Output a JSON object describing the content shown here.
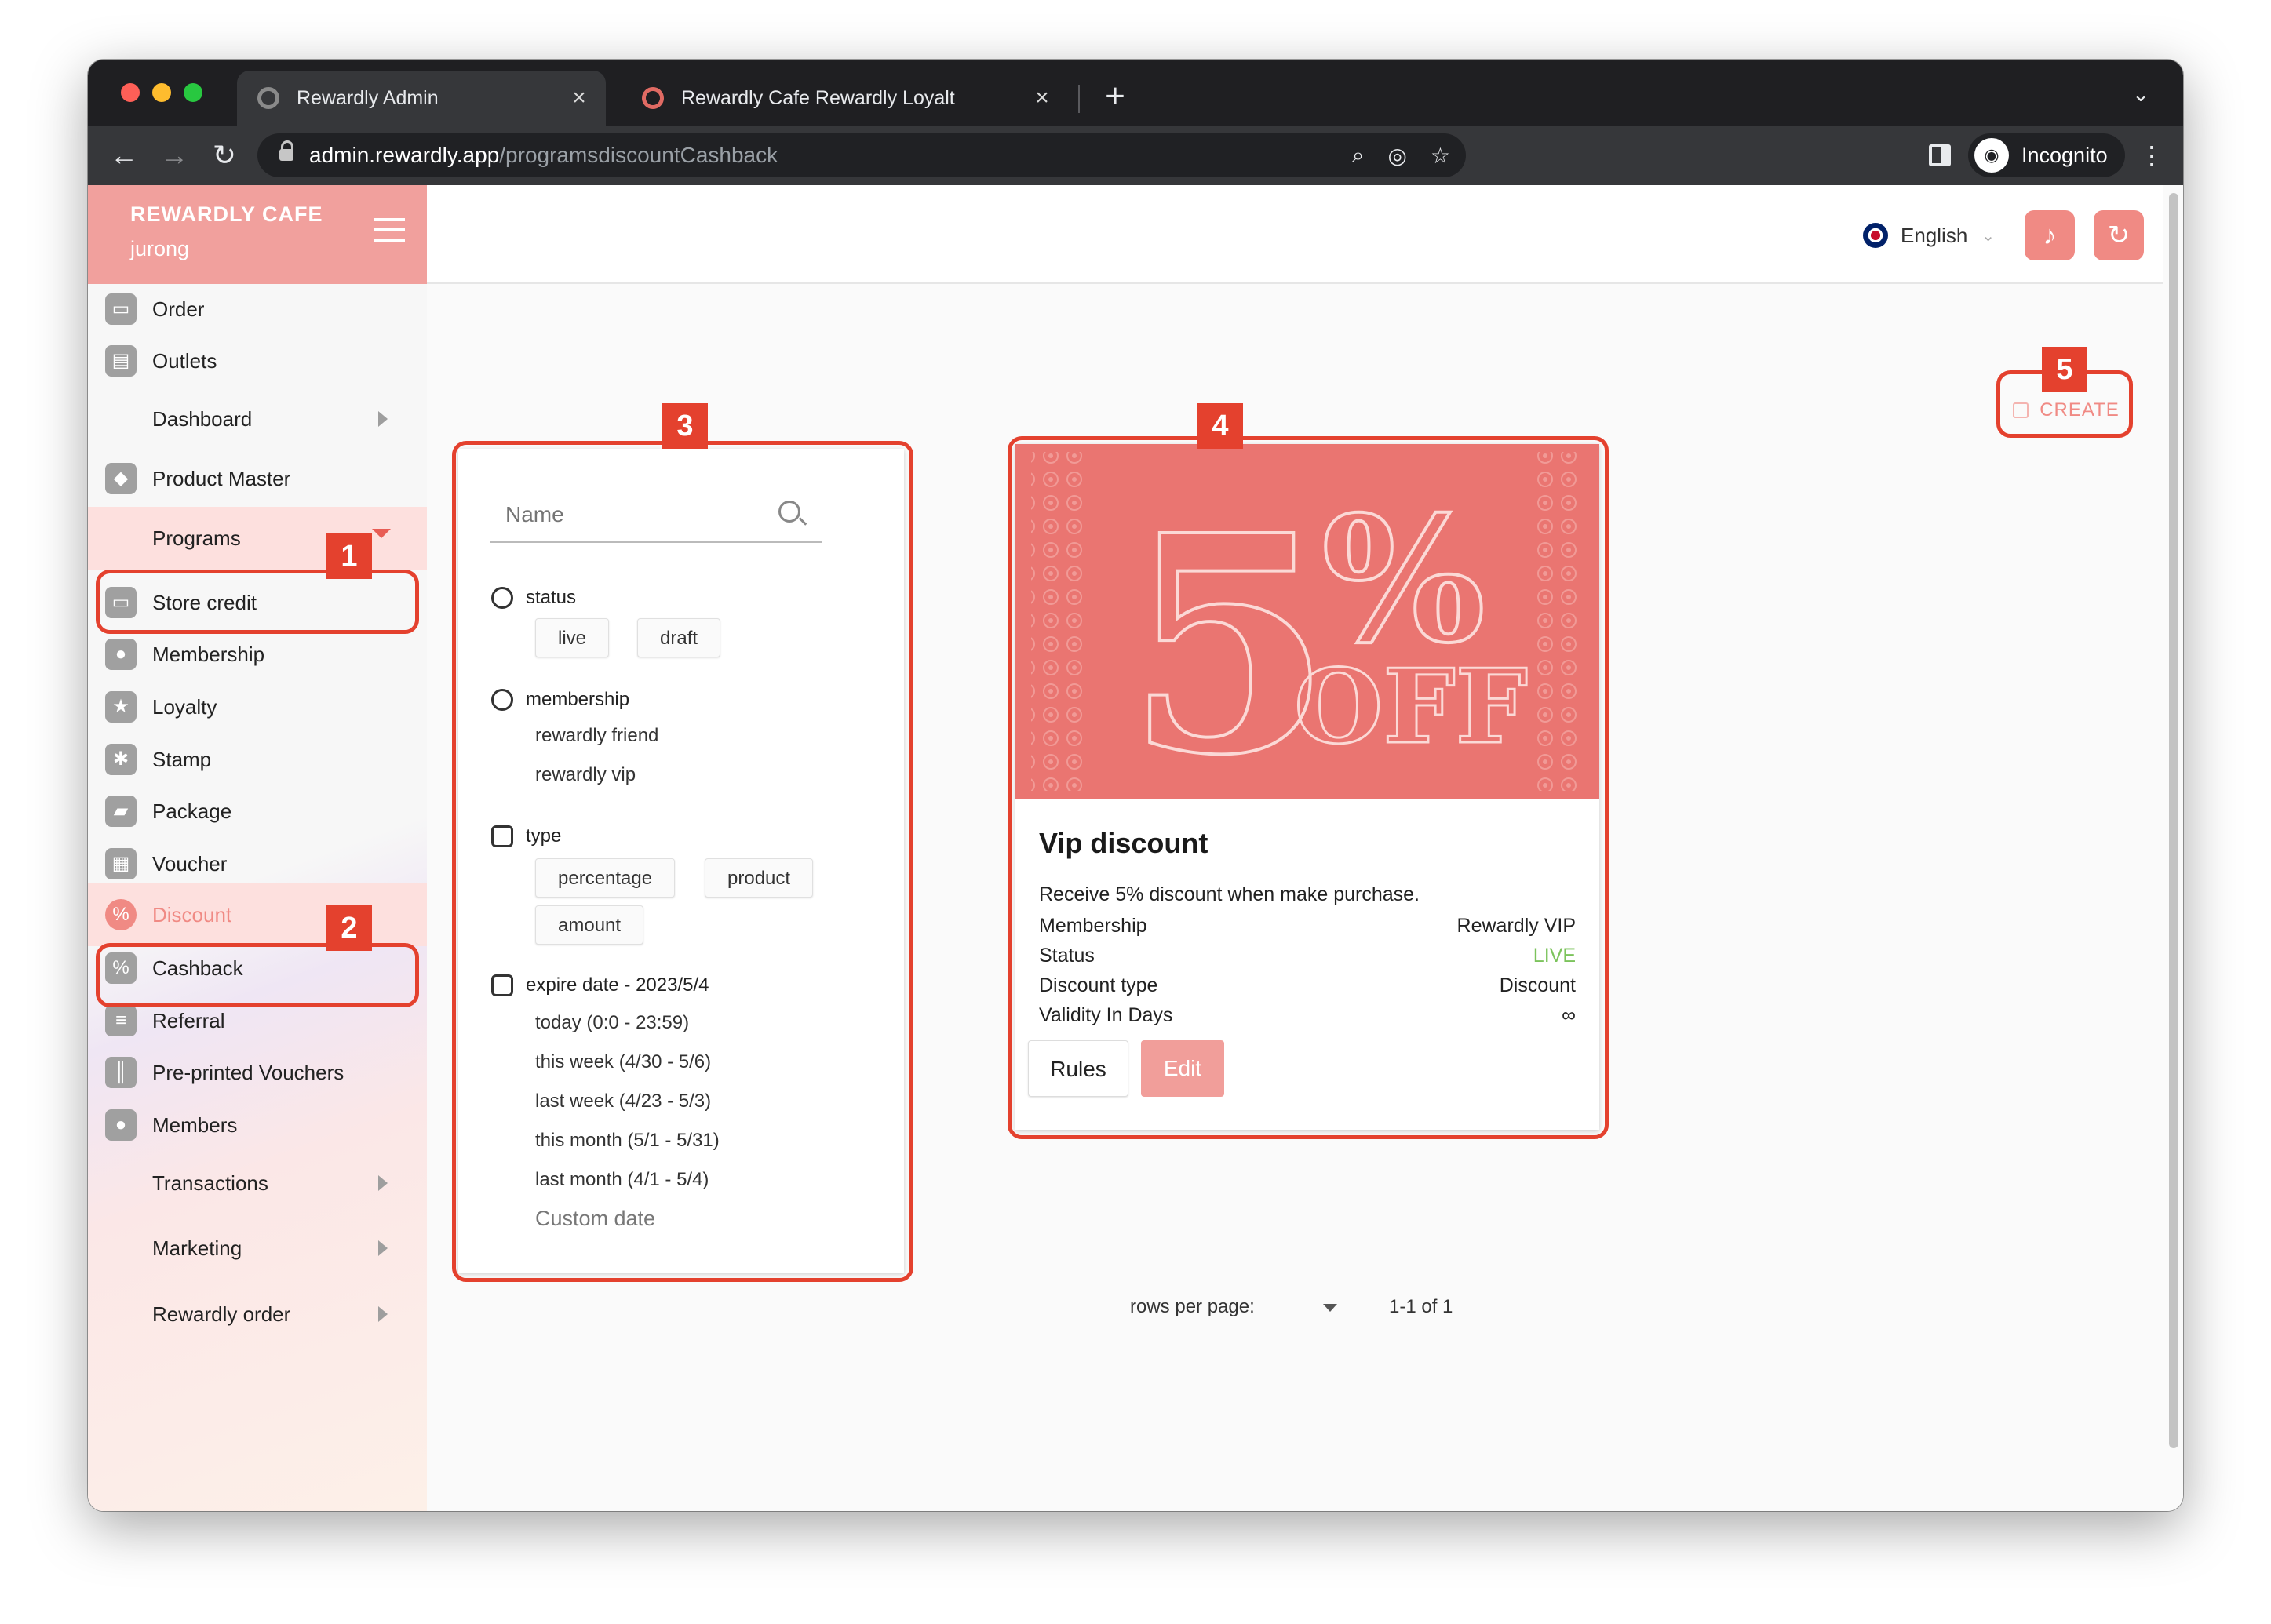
{
  "browser": {
    "tabs": [
      {
        "title": "Rewardly Admin",
        "active": true
      },
      {
        "title": "Rewardly Cafe Rewardly Loyalt",
        "active": false
      }
    ],
    "new_tab": "+",
    "url_domain": "admin.rewardly.app",
    "url_path": "/programsdiscountCashback",
    "profile_label": "Incognito"
  },
  "sidebar": {
    "brand": "REWARDLY CAFE",
    "outlet": "jurong",
    "items": [
      {
        "label": "Order"
      },
      {
        "label": "Outlets"
      },
      {
        "label": "Dashboard"
      },
      {
        "label": "Product Master"
      },
      {
        "label": "Programs"
      },
      {
        "label": "Store credit"
      },
      {
        "label": "Membership"
      },
      {
        "label": "Loyalty"
      },
      {
        "label": "Stamp"
      },
      {
        "label": "Package"
      },
      {
        "label": "Voucher"
      },
      {
        "label": "Discount"
      },
      {
        "label": "Cashback"
      },
      {
        "label": "Referral"
      },
      {
        "label": "Pre-printed Vouchers"
      },
      {
        "label": "Members"
      },
      {
        "label": "Transactions"
      },
      {
        "label": "Marketing"
      },
      {
        "label": "Rewardly order"
      }
    ]
  },
  "topbar": {
    "language": "English"
  },
  "create_button": "CREATE",
  "filters": {
    "search_placeholder": "Name",
    "status": {
      "label": "status",
      "options": [
        "live",
        "draft"
      ]
    },
    "membership": {
      "label": "membership",
      "options": [
        "rewardly friend",
        "rewardly vip"
      ]
    },
    "type": {
      "label": "type",
      "options": [
        "percentage",
        "product",
        "amount"
      ]
    },
    "expire": {
      "label": "expire date - 2023/5/4",
      "options": [
        "today (0:0 - 23:59)",
        "this week (4/30 - 5/6)",
        "last week (4/23 - 5/3)",
        "this month (5/1 - 5/31)",
        "last month (4/1 - 5/4)"
      ],
      "custom": "Custom date"
    }
  },
  "card": {
    "image_text": {
      "big": "5",
      "percent": "%",
      "off": "OFF"
    },
    "title": "Vip discount",
    "description": "Receive 5% discount when make purchase.",
    "rows": [
      {
        "key": "Membership",
        "value": "Rewardly VIP"
      },
      {
        "key": "Status",
        "value": "LIVE"
      },
      {
        "key": "Discount type",
        "value": "Discount"
      },
      {
        "key": "Validity In Days",
        "value": "∞"
      }
    ],
    "rules_button": "Rules",
    "edit_button": "Edit"
  },
  "pagination": {
    "rows_label": "rows per page:",
    "range": "1-1 of 1"
  },
  "annotations": [
    "1",
    "2",
    "3",
    "4",
    "5"
  ],
  "colors": {
    "accent": "#f08a84",
    "header": "#f1a09d",
    "annotation": "#e4412e",
    "live": "#7cc35c"
  }
}
